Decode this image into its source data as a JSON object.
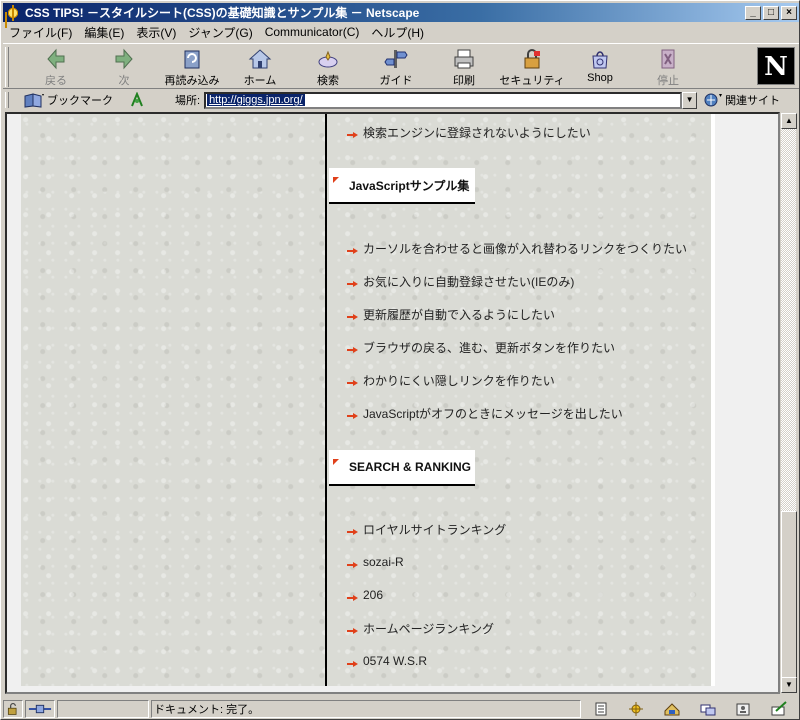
{
  "window": {
    "title": "CSS TIPS! －スタイルシート(CSS)の基礎知識とサンプル集 － Netscape",
    "minimize": "_",
    "maximize": "□",
    "close": "×"
  },
  "menu": [
    "ファイル(F)",
    "編集(E)",
    "表示(V)",
    "ジャンプ(G)",
    "Communicator(C)",
    "ヘルプ(H)"
  ],
  "toolbar": {
    "buttons": [
      {
        "label": "戻る",
        "icon": "back-arrow-icon",
        "enabled": false
      },
      {
        "label": "次",
        "icon": "forward-arrow-icon",
        "enabled": false
      },
      {
        "label": "再読み込み",
        "icon": "reload-icon",
        "enabled": true
      },
      {
        "label": "ホーム",
        "icon": "home-icon",
        "enabled": true
      },
      {
        "label": "検索",
        "icon": "search-icon",
        "enabled": true
      },
      {
        "label": "ガイド",
        "icon": "guide-icon",
        "enabled": true
      },
      {
        "label": "印刷",
        "icon": "print-icon",
        "enabled": true
      },
      {
        "label": "セキュリティ",
        "icon": "security-lock-icon",
        "enabled": true
      },
      {
        "label": "Shop",
        "icon": "shop-icon",
        "enabled": true
      },
      {
        "label": "停止",
        "icon": "stop-icon",
        "enabled": false
      }
    ],
    "logo": "N"
  },
  "location": {
    "bookmarks_label": "ブックマーク",
    "location_label": "場所:",
    "url": "http://giggs.jpn.org/",
    "related_label": "関連サイト"
  },
  "content": {
    "top_item": "検索エンジンに登録されないようにしたい",
    "sections": [
      {
        "heading": "JavaScriptサンプル集",
        "items": [
          "カーソルを合わせると画像が入れ替わるリンクをつくりたい",
          "お気に入りに自動登録させたい(IEのみ)",
          "更新履歴が自動で入るようにしたい",
          "ブラウザの戻る、進む、更新ボタンを作りたい",
          "わかりにくい隠しリンクを作りたい",
          "JavaScriptがオフのときにメッセージを出したい"
        ]
      },
      {
        "heading": "SEARCH & RANKING",
        "items": [
          "ロイヤルサイトランキング",
          "sozai-R",
          "206",
          "ホームページランキング",
          "0574 W.S.R"
        ]
      }
    ]
  },
  "status": {
    "text": "ドキュメント: 完了。"
  },
  "colors": {
    "titlebar_start": "#0a246a",
    "titlebar_end": "#a6caf0",
    "arrow": "#e0401a",
    "page_bg": "#dadbd5"
  }
}
